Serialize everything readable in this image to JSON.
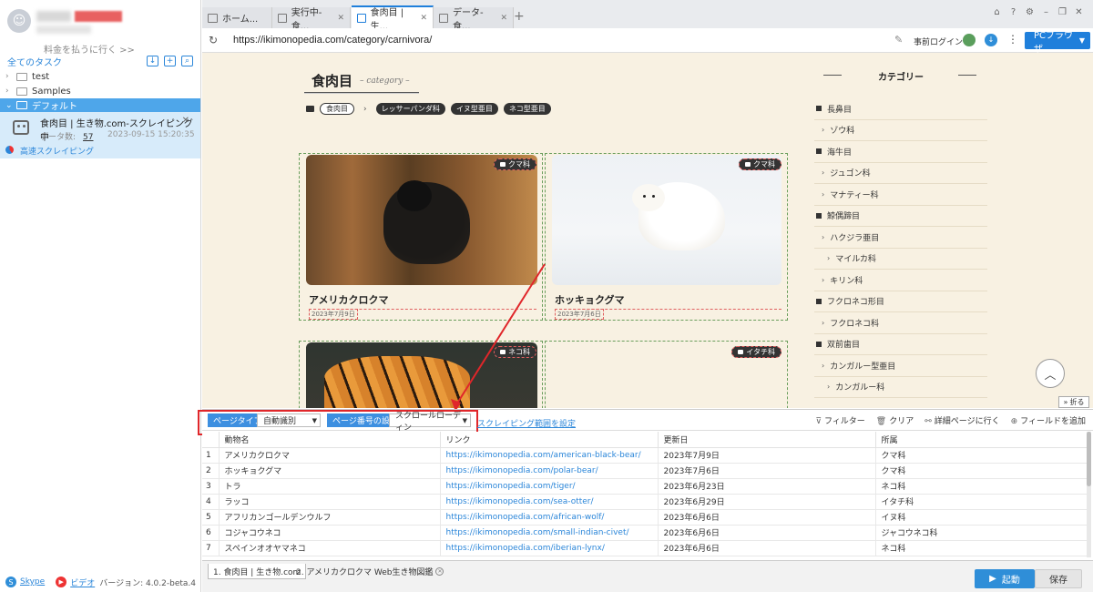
{
  "sidebar": {
    "pay_link": "料金を払うに行く >>",
    "all_tasks": "全てのタスク",
    "folders": [
      {
        "label": "test"
      },
      {
        "label": "Samples"
      },
      {
        "label": "デフォルト"
      }
    ],
    "task": {
      "name": "食肉目 | 生き物.com-スクレイピング中",
      "count_label": "データ数:",
      "count": "57",
      "date": "2023-09-15 15:20:35",
      "mode": "高速スクレイピング"
    },
    "footer": {
      "skype": "Skype",
      "video": "ビデオ",
      "version": "バージョン: 4.0.2-beta.4"
    }
  },
  "tabs": [
    {
      "label": "ホーム..."
    },
    {
      "label": "実行中-食..."
    },
    {
      "label": "食肉目 | 生..."
    },
    {
      "label": "データ-食..."
    }
  ],
  "address": {
    "url": "https://ikimonopedia.com/category/carnivora/",
    "login": "事前ログイン",
    "browser": "PCブラウザ"
  },
  "page": {
    "title": "食肉目",
    "subtitle": "– category –",
    "crumb_current": "食肉目",
    "crumb_tags": [
      "レッサーパンダ科",
      "イヌ型亜目",
      "ネコ型亜目"
    ],
    "cards": [
      {
        "name": "アメリカクロクマ",
        "tag": "クマ科",
        "date": "2023年7月9日"
      },
      {
        "name": "ホッキョクグマ",
        "tag": "クマ科",
        "date": "2023年7月6日"
      },
      {
        "name": "",
        "tag": "ネコ科",
        "date": ""
      },
      {
        "name": "",
        "tag": "イタチ科",
        "date": ""
      }
    ],
    "category_title": "カテゴリー",
    "categories": [
      {
        "level": 1,
        "label": "長鼻目"
      },
      {
        "level": 2,
        "label": "ゾウ科"
      },
      {
        "level": 1,
        "label": "海牛目"
      },
      {
        "level": 2,
        "label": "ジュゴン科"
      },
      {
        "level": 2,
        "label": "マナティー科"
      },
      {
        "level": 1,
        "label": "鯨偶蹄目"
      },
      {
        "level": 2,
        "label": "ハクジラ亜目"
      },
      {
        "level": 3,
        "label": "マイルカ科"
      },
      {
        "level": 2,
        "label": "キリン科"
      },
      {
        "level": 1,
        "label": "フクロネコ形目"
      },
      {
        "level": 2,
        "label": "フクロネコ科"
      },
      {
        "level": 1,
        "label": "双前歯目"
      },
      {
        "level": 2,
        "label": "カンガルー型亜目"
      },
      {
        "level": 3,
        "label": "カンガルー科"
      }
    ],
    "fold_label": "折る"
  },
  "config": {
    "page_type_label": "ページタイプ",
    "page_type_value": "自動識別",
    "page_num_label": "ページ番号の設定",
    "page_num_value": "スクロールローディン",
    "range_link": "スクレイピング範囲を設定",
    "tools": [
      "フィルター",
      "クリア",
      "詳細ページに行く",
      "フィールドを追加"
    ]
  },
  "table": {
    "columns": [
      "動物名",
      "リンク",
      "更新日",
      "所属"
    ],
    "rows": [
      [
        "1",
        "アメリカクロクマ",
        "https://ikimonopedia.com/american-black-bear/",
        "2023年7月9日",
        "クマ科"
      ],
      [
        "2",
        "ホッキョクグマ",
        "https://ikimonopedia.com/polar-bear/",
        "2023年7月6日",
        "クマ科"
      ],
      [
        "3",
        "トラ",
        "https://ikimonopedia.com/tiger/",
        "2023年6月23日",
        "ネコ科"
      ],
      [
        "4",
        "ラッコ",
        "https://ikimonopedia.com/sea-otter/",
        "2023年6月29日",
        "イタチ科"
      ],
      [
        "5",
        "アフリカンゴールデンウルフ",
        "https://ikimonopedia.com/african-wolf/",
        "2023年6月6日",
        "イヌ科"
      ],
      [
        "6",
        "コジャコウネコ",
        "https://ikimonopedia.com/small-indian-civet/",
        "2023年6月6日",
        "ジャコウネコ科"
      ],
      [
        "7",
        "スペインオオヤマネコ",
        "https://ikimonopedia.com/iberian-lynx/",
        "2023年6月6日",
        "ネコ科"
      ]
    ]
  },
  "bottom": {
    "tabs": [
      "1. 食肉目 | 生き物.com",
      "2. アメリカクロクマ Web生き物図鑑"
    ],
    "start": "起動",
    "save": "保存"
  },
  "colors": {
    "accent": "#1f7fdb",
    "highlight": "#e0262a",
    "page_bg": "#f8f1e2"
  }
}
